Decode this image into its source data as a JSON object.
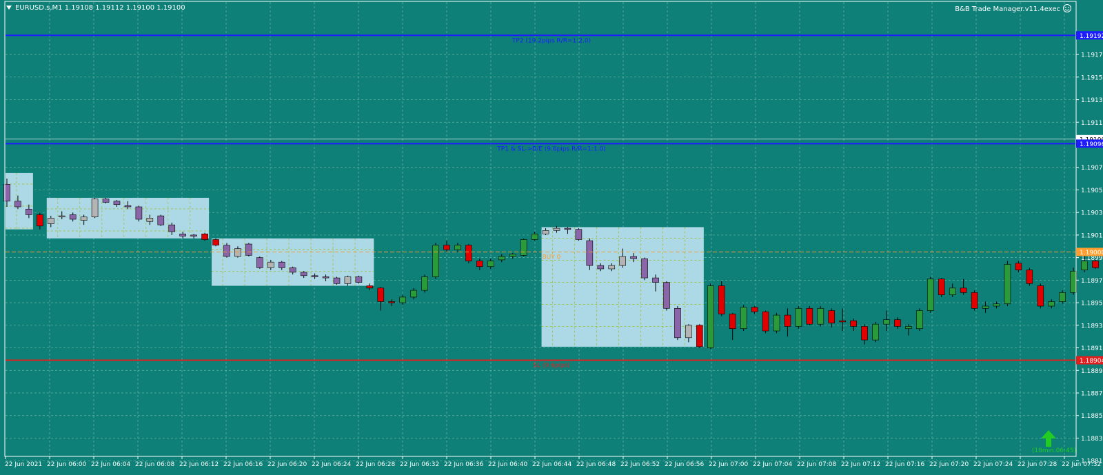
{
  "header": {
    "symbol_info": "EURUSD.s,M1  1.19108 1.19112 1.19100 1.19100",
    "ea_label": "B&B Trade Manager.v11.4exec"
  },
  "colors": {
    "background": "#0e8078",
    "grid": "#8cc8b4",
    "zone_fill": "#add8e6",
    "bull": "#2a9a3a",
    "bear": "#e00000",
    "neutral_bull": "#b4b4b4",
    "neutral_bear": "#8a66a8",
    "tp_line": "#1c1cff",
    "sl_line": "#e02020",
    "entry_line": "#ff9d2e",
    "axis_text": "#ffffff"
  },
  "trade_levels": {
    "tp2": {
      "price": 1.19192,
      "label": "TP2 (19.2pips R/R=1:2.0)",
      "tag": "1.19192"
    },
    "tp1": {
      "price": 1.19096,
      "label": "TP1 & SL->B/E (9.6pips R/R=1:1.0)",
      "tag": "1.19096"
    },
    "tp1_aux_tag": "1.19100",
    "entry": {
      "price": 1.19,
      "label": "BUY 0",
      "tag": "1.19000"
    },
    "sl": {
      "price": 1.18904,
      "label": "SL (9.6pips)",
      "tag": "1.18904"
    }
  },
  "arrow_note": "(18min.06:45)",
  "chart_data": {
    "type": "candlestick",
    "y_ticks": [
      "1.19175",
      "1.19155",
      "1.19135",
      "1.19115",
      "1.19075",
      "1.19055",
      "1.19035",
      "1.19015",
      "1.18995",
      "1.18975",
      "1.18955",
      "1.18935",
      "1.18915",
      "1.18895",
      "1.18875",
      "1.18855",
      "1.18835",
      "1.18815"
    ],
    "ylim": [
      1.18806,
      1.19205
    ],
    "x_ticks": [
      "22 Jun 2021",
      "22 Jun 06:00",
      "22 Jun 06:04",
      "22 Jun 06:08",
      "22 Jun 06:12",
      "22 Jun 06:16",
      "22 Jun 06:20",
      "22 Jun 06:24",
      "22 Jun 06:28",
      "22 Jun 06:32",
      "22 Jun 06:36",
      "22 Jun 06:40",
      "22 Jun 06:44",
      "22 Jun 06:48",
      "22 Jun 06:52",
      "22 Jun 06:56",
      "22 Jun 07:00",
      "22 Jun 07:04",
      "22 Jun 07:08",
      "22 Jun 07:12",
      "22 Jun 07:16",
      "22 Jun 07:20",
      "22 Jun 07:24",
      "22 Jun 07:28",
      "22 Jun 07:32"
    ],
    "zones": [
      {
        "start": 0,
        "end": 2,
        "high": 1.1907,
        "low": 1.1902
      },
      {
        "start": 4,
        "end": 18,
        "high": 1.19048,
        "low": 1.19012
      },
      {
        "start": 19,
        "end": 33,
        "high": 1.19012,
        "low": 1.1897
      },
      {
        "start": 49,
        "end": 63,
        "high": 1.19022,
        "low": 1.18916
      }
    ],
    "candles": [
      {
        "o": 1.1906,
        "h": 1.19065,
        "l": 1.1904,
        "c": 1.19045,
        "s": "nbear"
      },
      {
        "o": 1.19045,
        "h": 1.1905,
        "l": 1.19038,
        "c": 1.1904,
        "s": "nbear"
      },
      {
        "o": 1.19038,
        "h": 1.19042,
        "l": 1.1903,
        "c": 1.19033,
        "s": "nbear"
      },
      {
        "o": 1.19033,
        "h": 1.19035,
        "l": 1.1902,
        "c": 1.19023,
        "s": "bear"
      },
      {
        "o": 1.19025,
        "h": 1.19032,
        "l": 1.19022,
        "c": 1.1903,
        "s": "nbull"
      },
      {
        "o": 1.19031,
        "h": 1.19036,
        "l": 1.19029,
        "c": 1.19032,
        "s": "nbull"
      },
      {
        "o": 1.19033,
        "h": 1.19035,
        "l": 1.19027,
        "c": 1.19029,
        "s": "nbear"
      },
      {
        "o": 1.19028,
        "h": 1.19033,
        "l": 1.19024,
        "c": 1.19031,
        "s": "nbull"
      },
      {
        "o": 1.19031,
        "h": 1.19048,
        "l": 1.1903,
        "c": 1.19047,
        "s": "nbull"
      },
      {
        "o": 1.19047,
        "h": 1.19048,
        "l": 1.19043,
        "c": 1.19044,
        "s": "nbear"
      },
      {
        "o": 1.19045,
        "h": 1.19046,
        "l": 1.1904,
        "c": 1.19042,
        "s": "nbear"
      },
      {
        "o": 1.19041,
        "h": 1.19045,
        "l": 1.19038,
        "c": 1.1904,
        "s": "nbear"
      },
      {
        "o": 1.1904,
        "h": 1.19041,
        "l": 1.19027,
        "c": 1.19029,
        "s": "nbear"
      },
      {
        "o": 1.19027,
        "h": 1.19033,
        "l": 1.19024,
        "c": 1.1903,
        "s": "nbull"
      },
      {
        "o": 1.19032,
        "h": 1.19033,
        "l": 1.19023,
        "c": 1.19024,
        "s": "nbear"
      },
      {
        "o": 1.19024,
        "h": 1.19026,
        "l": 1.19015,
        "c": 1.19018,
        "s": "nbear"
      },
      {
        "o": 1.19016,
        "h": 1.19018,
        "l": 1.19012,
        "c": 1.19014,
        "s": "nbear"
      },
      {
        "o": 1.19015,
        "h": 1.19016,
        "l": 1.19012,
        "c": 1.19014,
        "s": "nbear"
      },
      {
        "o": 1.19016,
        "h": 1.19017,
        "l": 1.1901,
        "c": 1.19011,
        "s": "bear"
      },
      {
        "o": 1.19011,
        "h": 1.19012,
        "l": 1.19005,
        "c": 1.19006,
        "s": "bear"
      },
      {
        "o": 1.19006,
        "h": 1.19008,
        "l": 1.18995,
        "c": 1.18996,
        "s": "nbear"
      },
      {
        "o": 1.18996,
        "h": 1.19005,
        "l": 1.18995,
        "c": 1.19003,
        "s": "nbull"
      },
      {
        "o": 1.19007,
        "h": 1.19008,
        "l": 1.18996,
        "c": 1.18997,
        "s": "nbear"
      },
      {
        "o": 1.18995,
        "h": 1.18996,
        "l": 1.18985,
        "c": 1.18986,
        "s": "nbear"
      },
      {
        "o": 1.18986,
        "h": 1.18993,
        "l": 1.18984,
        "c": 1.18991,
        "s": "nbull"
      },
      {
        "o": 1.18991,
        "h": 1.18992,
        "l": 1.18984,
        "c": 1.18986,
        "s": "nbear"
      },
      {
        "o": 1.18986,
        "h": 1.18987,
        "l": 1.1898,
        "c": 1.18982,
        "s": "nbear"
      },
      {
        "o": 1.18982,
        "h": 1.18983,
        "l": 1.18977,
        "c": 1.18979,
        "s": "nbear"
      },
      {
        "o": 1.18979,
        "h": 1.18981,
        "l": 1.18976,
        "c": 1.18978,
        "s": "nbear"
      },
      {
        "o": 1.18978,
        "h": 1.1898,
        "l": 1.18974,
        "c": 1.18977,
        "s": "nbear"
      },
      {
        "o": 1.18977,
        "h": 1.18978,
        "l": 1.18971,
        "c": 1.18972,
        "s": "nbear"
      },
      {
        "o": 1.18972,
        "h": 1.18979,
        "l": 1.1897,
        "c": 1.18978,
        "s": "nbull"
      },
      {
        "o": 1.18978,
        "h": 1.18979,
        "l": 1.18972,
        "c": 1.18973,
        "s": "nbear"
      },
      {
        "o": 1.1897,
        "h": 1.18972,
        "l": 1.18966,
        "c": 1.18968,
        "s": "bear"
      },
      {
        "o": 1.18968,
        "h": 1.18969,
        "l": 1.18948,
        "c": 1.18956,
        "s": "bear"
      },
      {
        "o": 1.18956,
        "h": 1.18958,
        "l": 1.18952,
        "c": 1.18955,
        "s": "bear"
      },
      {
        "o": 1.18955,
        "h": 1.18962,
        "l": 1.18953,
        "c": 1.1896,
        "s": "bull"
      },
      {
        "o": 1.1896,
        "h": 1.18968,
        "l": 1.18958,
        "c": 1.18966,
        "s": "bull"
      },
      {
        "o": 1.18966,
        "h": 1.1898,
        "l": 1.18964,
        "c": 1.18978,
        "s": "bull"
      },
      {
        "o": 1.18978,
        "h": 1.19008,
        "l": 1.18976,
        "c": 1.19006,
        "s": "bull"
      },
      {
        "o": 1.19006,
        "h": 1.1901,
        "l": 1.19,
        "c": 1.19002,
        "s": "bear"
      },
      {
        "o": 1.19002,
        "h": 1.19008,
        "l": 1.19,
        "c": 1.19006,
        "s": "bull"
      },
      {
        "o": 1.19006,
        "h": 1.19007,
        "l": 1.1899,
        "c": 1.18992,
        "s": "bear"
      },
      {
        "o": 1.18992,
        "h": 1.18994,
        "l": 1.18984,
        "c": 1.18987,
        "s": "bear"
      },
      {
        "o": 1.18987,
        "h": 1.18994,
        "l": 1.18985,
        "c": 1.18992,
        "s": "bull"
      },
      {
        "o": 1.18993,
        "h": 1.18998,
        "l": 1.18991,
        "c": 1.18996,
        "s": "bull"
      },
      {
        "o": 1.18996,
        "h": 1.18999,
        "l": 1.18994,
        "c": 1.18998,
        "s": "bull"
      },
      {
        "o": 1.18997,
        "h": 1.19012,
        "l": 1.18996,
        "c": 1.19011,
        "s": "bull"
      },
      {
        "o": 1.19011,
        "h": 1.19018,
        "l": 1.1901,
        "c": 1.19016,
        "s": "bull"
      },
      {
        "o": 1.19016,
        "h": 1.19021,
        "l": 1.19015,
        "c": 1.19019,
        "s": "nbull"
      },
      {
        "o": 1.19019,
        "h": 1.19023,
        "l": 1.19017,
        "c": 1.19021,
        "s": "nbull"
      },
      {
        "o": 1.19021,
        "h": 1.19022,
        "l": 1.19016,
        "c": 1.1902,
        "s": "nbear"
      },
      {
        "o": 1.1902,
        "h": 1.19021,
        "l": 1.1901,
        "c": 1.19011,
        "s": "nbear"
      },
      {
        "o": 1.1901,
        "h": 1.19012,
        "l": 1.18984,
        "c": 1.18988,
        "s": "nbear"
      },
      {
        "o": 1.18988,
        "h": 1.1899,
        "l": 1.18983,
        "c": 1.18985,
        "s": "nbear"
      },
      {
        "o": 1.18985,
        "h": 1.1899,
        "l": 1.18983,
        "c": 1.18988,
        "s": "nbull"
      },
      {
        "o": 1.18988,
        "h": 1.19003,
        "l": 1.18986,
        "c": 1.18996,
        "s": "nbull"
      },
      {
        "o": 1.18996,
        "h": 1.18999,
        "l": 1.18991,
        "c": 1.18994,
        "s": "nbear"
      },
      {
        "o": 1.18994,
        "h": 1.18995,
        "l": 1.18975,
        "c": 1.18977,
        "s": "nbear"
      },
      {
        "o": 1.18977,
        "h": 1.1898,
        "l": 1.18965,
        "c": 1.18973,
        "s": "nbear"
      },
      {
        "o": 1.18973,
        "h": 1.18974,
        "l": 1.18948,
        "c": 1.1895,
        "s": "nbear"
      },
      {
        "o": 1.1895,
        "h": 1.18952,
        "l": 1.18922,
        "c": 1.18924,
        "s": "nbear"
      },
      {
        "o": 1.18924,
        "h": 1.18936,
        "l": 1.1892,
        "c": 1.18935,
        "s": "nbull"
      },
      {
        "o": 1.18935,
        "h": 1.18936,
        "l": 1.18915,
        "c": 1.18916,
        "s": "bear"
      },
      {
        "o": 1.18915,
        "h": 1.18972,
        "l": 1.18914,
        "c": 1.1897,
        "s": "bull"
      },
      {
        "o": 1.1897,
        "h": 1.18974,
        "l": 1.18943,
        "c": 1.18945,
        "s": "bear"
      },
      {
        "o": 1.18945,
        "h": 1.18946,
        "l": 1.18922,
        "c": 1.18932,
        "s": "bear"
      },
      {
        "o": 1.18932,
        "h": 1.18953,
        "l": 1.1893,
        "c": 1.18951,
        "s": "bull"
      },
      {
        "o": 1.18951,
        "h": 1.18952,
        "l": 1.18945,
        "c": 1.18947,
        "s": "bear"
      },
      {
        "o": 1.18947,
        "h": 1.18948,
        "l": 1.18928,
        "c": 1.1893,
        "s": "bear"
      },
      {
        "o": 1.1893,
        "h": 1.18946,
        "l": 1.18928,
        "c": 1.18944,
        "s": "bull"
      },
      {
        "o": 1.18944,
        "h": 1.1895,
        "l": 1.18925,
        "c": 1.18934,
        "s": "bear"
      },
      {
        "o": 1.18934,
        "h": 1.18952,
        "l": 1.18932,
        "c": 1.1895,
        "s": "bull"
      },
      {
        "o": 1.1895,
        "h": 1.18952,
        "l": 1.18935,
        "c": 1.18936,
        "s": "bear"
      },
      {
        "o": 1.18936,
        "h": 1.18952,
        "l": 1.18934,
        "c": 1.1895,
        "s": "bull"
      },
      {
        "o": 1.18948,
        "h": 1.1895,
        "l": 1.18933,
        "c": 1.18937,
        "s": "bear"
      },
      {
        "o": 1.18938,
        "h": 1.1895,
        "l": 1.1893,
        "c": 1.18939,
        "s": "bear"
      },
      {
        "o": 1.18939,
        "h": 1.18941,
        "l": 1.1893,
        "c": 1.18934,
        "s": "bear"
      },
      {
        "o": 1.18934,
        "h": 1.18936,
        "l": 1.18918,
        "c": 1.18922,
        "s": "bear"
      },
      {
        "o": 1.18922,
        "h": 1.18938,
        "l": 1.1892,
        "c": 1.18936,
        "s": "bull"
      },
      {
        "o": 1.18936,
        "h": 1.18948,
        "l": 1.1893,
        "c": 1.1894,
        "s": "bull"
      },
      {
        "o": 1.1894,
        "h": 1.18942,
        "l": 1.18932,
        "c": 1.18934,
        "s": "bear"
      },
      {
        "o": 1.18934,
        "h": 1.18936,
        "l": 1.18926,
        "c": 1.18932,
        "s": "bull"
      },
      {
        "o": 1.18932,
        "h": 1.1895,
        "l": 1.1893,
        "c": 1.18948,
        "s": "bull"
      },
      {
        "o": 1.18948,
        "h": 1.18978,
        "l": 1.18946,
        "c": 1.18976,
        "s": "bull"
      },
      {
        "o": 1.18976,
        "h": 1.18977,
        "l": 1.1896,
        "c": 1.18962,
        "s": "bear"
      },
      {
        "o": 1.18962,
        "h": 1.18972,
        "l": 1.1896,
        "c": 1.18968,
        "s": "bull"
      },
      {
        "o": 1.18968,
        "h": 1.18976,
        "l": 1.18962,
        "c": 1.18964,
        "s": "bear"
      },
      {
        "o": 1.18964,
        "h": 1.18966,
        "l": 1.18948,
        "c": 1.1895,
        "s": "bear"
      },
      {
        "o": 1.1895,
        "h": 1.18956,
        "l": 1.18946,
        "c": 1.18952,
        "s": "bull"
      },
      {
        "o": 1.18952,
        "h": 1.18956,
        "l": 1.1895,
        "c": 1.18954,
        "s": "bull"
      },
      {
        "o": 1.18954,
        "h": 1.18992,
        "l": 1.18952,
        "c": 1.18989,
        "s": "bull"
      },
      {
        "o": 1.1899,
        "h": 1.18992,
        "l": 1.18982,
        "c": 1.18984,
        "s": "bear"
      },
      {
        "o": 1.18984,
        "h": 1.18986,
        "l": 1.1897,
        "c": 1.18972,
        "s": "bear"
      },
      {
        "o": 1.1897,
        "h": 1.18972,
        "l": 1.1895,
        "c": 1.18952,
        "s": "bear"
      },
      {
        "o": 1.18952,
        "h": 1.18958,
        "l": 1.1895,
        "c": 1.18956,
        "s": "bull"
      },
      {
        "o": 1.18956,
        "h": 1.18966,
        "l": 1.18954,
        "c": 1.18964,
        "s": "bull"
      },
      {
        "o": 1.18964,
        "h": 1.18986,
        "l": 1.18962,
        "c": 1.18983,
        "s": "bull"
      },
      {
        "o": 1.18984,
        "h": 1.18998,
        "l": 1.18982,
        "c": 1.18992,
        "s": "bull"
      },
      {
        "o": 1.18992,
        "h": 1.18994,
        "l": 1.18985,
        "c": 1.18986,
        "s": "bear"
      }
    ]
  }
}
